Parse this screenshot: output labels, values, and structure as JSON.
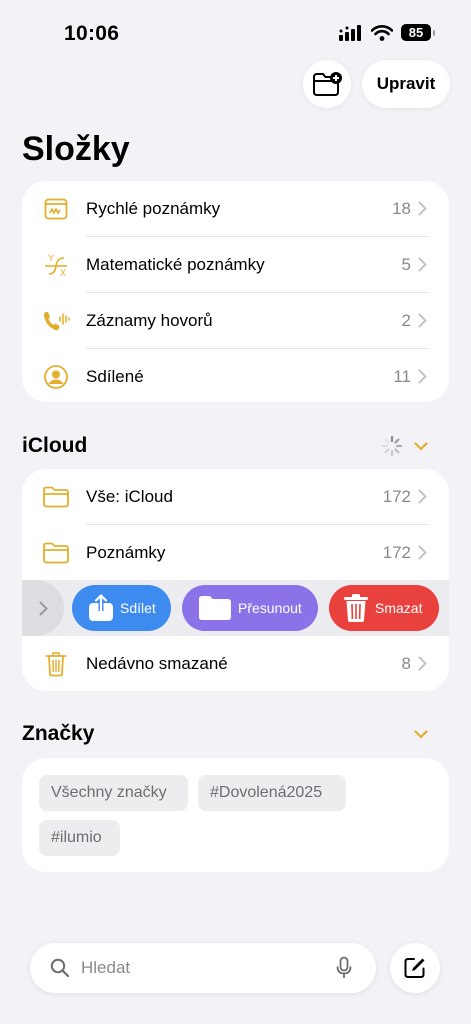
{
  "status": {
    "time": "10:06",
    "battery": "85"
  },
  "toolbar": {
    "edit_label": "Upravit"
  },
  "page_title": "Složky",
  "colors": {
    "accent": "#E3AE2B",
    "share": "#3E8BEF",
    "move": "#8B72E8",
    "delete": "#E9423E"
  },
  "quick_folders": [
    {
      "label": "Rychlé poznámky",
      "count": "18",
      "icon": "quick-notes-icon"
    },
    {
      "label": "Matematické poznámky",
      "count": "5",
      "icon": "math-notes-icon"
    },
    {
      "label": "Záznamy hovorů",
      "count": "2",
      "icon": "call-recording-icon"
    },
    {
      "label": "Sdílené",
      "count": "11",
      "icon": "shared-person-icon"
    }
  ],
  "icloud": {
    "title": "iCloud",
    "folders": [
      {
        "label": "Vše: iCloud",
        "count": "172",
        "icon": "folder-icon"
      },
      {
        "label": "Poznámky",
        "count": "172",
        "icon": "folder-icon"
      }
    ],
    "swipe_actions": {
      "share": "Sdílet",
      "move": "Přesunout",
      "delete": "Smazat"
    },
    "recently_deleted": {
      "label": "Nedávno smazané",
      "count": "8",
      "icon": "trash-icon"
    }
  },
  "tags": {
    "title": "Značky",
    "items": [
      "Všechny značky",
      "#Dovolená2025",
      "#ilumio"
    ]
  },
  "search": {
    "placeholder": "Hledat"
  }
}
